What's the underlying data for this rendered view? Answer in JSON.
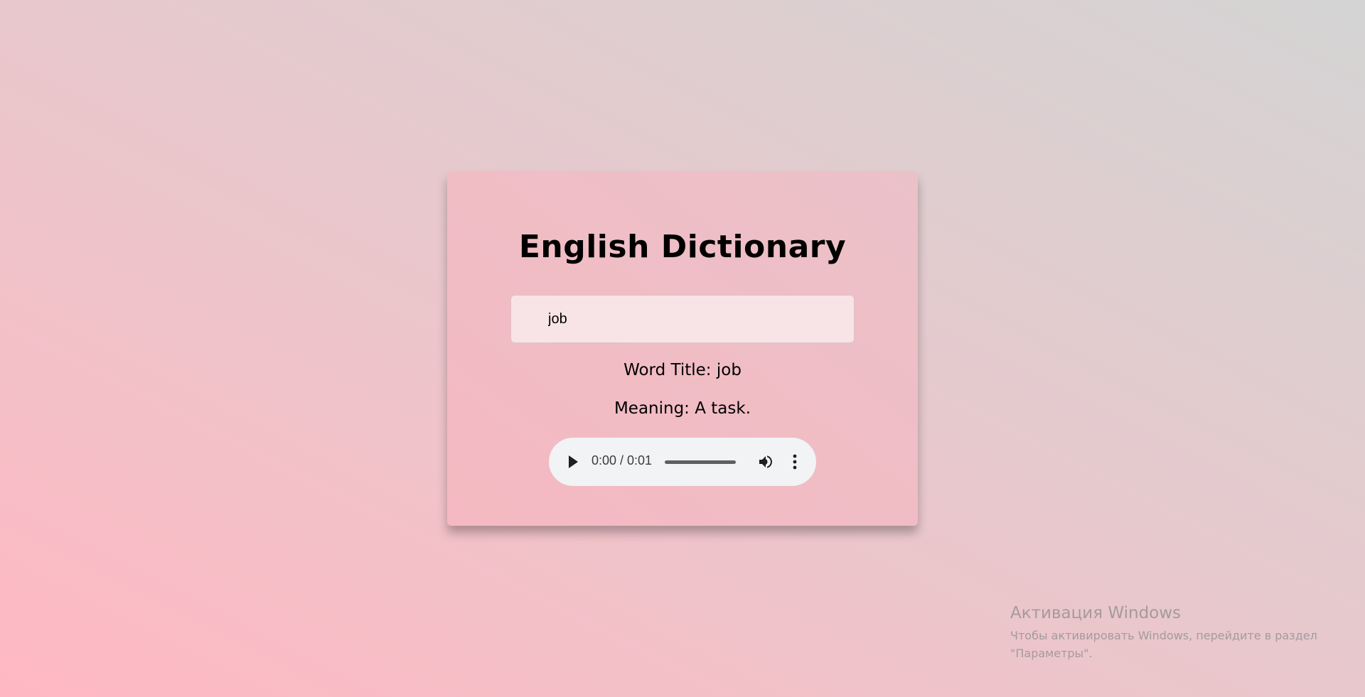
{
  "app": {
    "title": "English Dictionary",
    "search_value": "job"
  },
  "result": {
    "word_title": "Word Title: job",
    "meaning": "Meaning: A task."
  },
  "audio_player": {
    "time_display": "0:00 / 0:01",
    "progress_fraction": 0,
    "play_icon": "play-icon",
    "volume_icon": "volume-icon",
    "menu_icon": "more-vertical-icon"
  },
  "windows_activation": {
    "title": "Активация Windows",
    "line1": "Чтобы активировать Windows, перейдите в раздел",
    "line2": "\"Параметры\"."
  },
  "colors": {
    "card_background": "#f0bec6",
    "page_gradient_start": "#ffb8c3",
    "page_gradient_end": "#d4d4d4",
    "audio_background": "#f1f3f4"
  }
}
